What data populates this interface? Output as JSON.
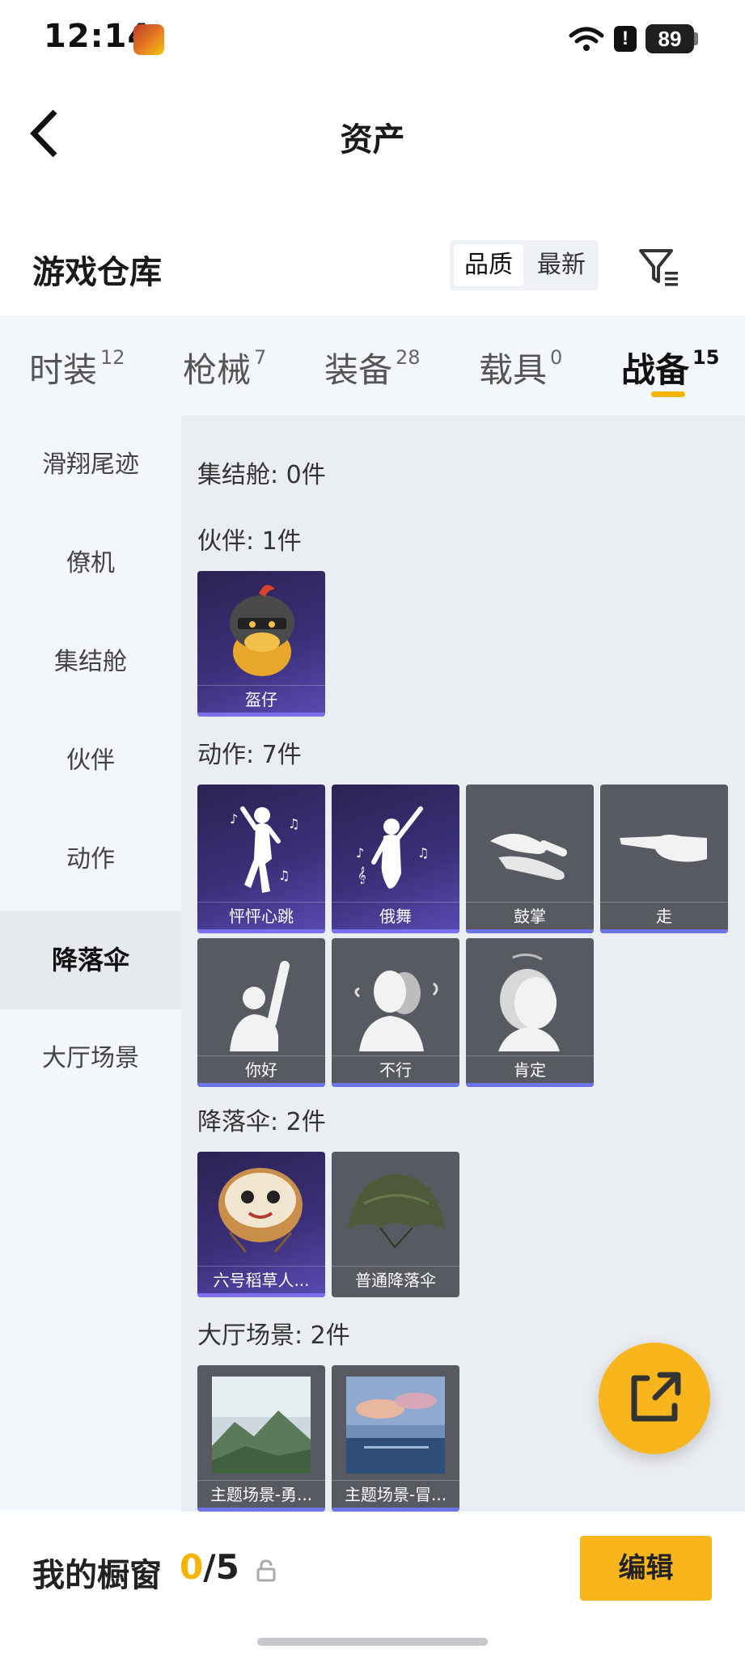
{
  "status_bar": {
    "time": "12:14",
    "battery": "89",
    "alert": "!"
  },
  "nav": {
    "title": "资产"
  },
  "header": {
    "title": "游戏仓库",
    "sort_options": [
      "品质",
      "最新"
    ]
  },
  "tabs": [
    {
      "label": "时装",
      "count": "12"
    },
    {
      "label": "枪械",
      "count": "7"
    },
    {
      "label": "装备",
      "count": "28"
    },
    {
      "label": "载具",
      "count": "0"
    },
    {
      "label": "战备",
      "count": "15"
    }
  ],
  "side_nav": [
    "滑翔尾迹",
    "僚机",
    "集结舱",
    "伙伴",
    "动作",
    "降落伞",
    "大厅场景"
  ],
  "groups": {
    "rally": {
      "title": "集结舱: 0件"
    },
    "partner": {
      "title": "伙伴: 1件",
      "items": [
        "盔仔"
      ]
    },
    "action": {
      "title": "动作: 7件",
      "items": [
        "怦怦心跳",
        "俄舞",
        "鼓掌",
        "走",
        "你好",
        "不行",
        "肯定"
      ]
    },
    "parachute": {
      "title": "降落伞: 2件",
      "items": [
        "六号稻草人...",
        "普通降落伞"
      ]
    },
    "lobby": {
      "title": "大厅场景: 2件",
      "items": [
        "主题场景-勇...",
        "主题场景-冒..."
      ]
    }
  },
  "bottom": {
    "window_title": "我的橱窗",
    "used": "0",
    "sep": "/",
    "max": "5",
    "edit_label": "编辑"
  },
  "colors": {
    "accent": "#f8b61c",
    "rarity_purple": "#3a2f78",
    "rarity_gray": "#585a62",
    "rarity_bar": "#6d74e8"
  }
}
